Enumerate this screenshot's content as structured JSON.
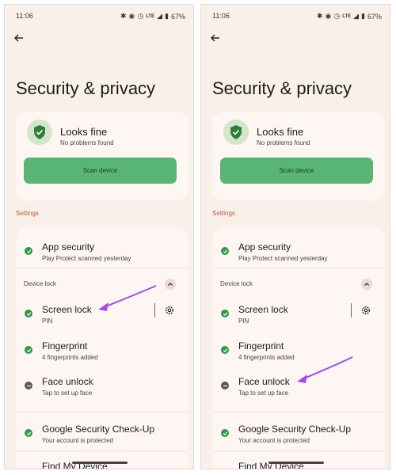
{
  "screens": [
    {
      "status": {
        "time": "11:06",
        "battery": "67%",
        "network": "LTE"
      },
      "page_title": "Security & privacy",
      "summary": {
        "title": "Looks fine",
        "subtitle": "No problems found",
        "scan_label": "Scan device"
      },
      "settings_label": "Settings",
      "items": {
        "app_security": {
          "title": "App security",
          "subtitle": "Play Protect scanned yesterday",
          "status": "ok"
        },
        "device_lock_label": "Device lock",
        "screen_lock": {
          "title": "Screen lock",
          "subtitle": "PIN",
          "status": "ok"
        },
        "fingerprint": {
          "title": "Fingerprint",
          "subtitle": "4 fingerprints added",
          "status": "ok"
        },
        "face_unlock": {
          "title": "Face unlock",
          "subtitle": "Tap to set up face",
          "status": "off"
        },
        "google_checkup": {
          "title": "Google Security Check-Up",
          "subtitle": "Your account is protected",
          "status": "ok"
        },
        "find_device": {
          "title": "Find My Device"
        }
      },
      "highlight": "screen_lock"
    },
    {
      "status": {
        "time": "11:06",
        "battery": "67%",
        "network": "LTE"
      },
      "page_title": "Security & privacy",
      "summary": {
        "title": "Looks fine",
        "subtitle": "No problems found",
        "scan_label": "Scan device"
      },
      "settings_label": "Settings",
      "items": {
        "app_security": {
          "title": "App security",
          "subtitle": "Play Protect scanned yesterday",
          "status": "ok"
        },
        "device_lock_label": "Device lock",
        "screen_lock": {
          "title": "Screen lock",
          "subtitle": "PIN",
          "status": "ok"
        },
        "fingerprint": {
          "title": "Fingerprint",
          "subtitle": "4 fingerprints added",
          "status": "ok"
        },
        "face_unlock": {
          "title": "Face unlock",
          "subtitle": "Tap to set up face",
          "status": "off"
        },
        "google_checkup": {
          "title": "Google Security Check-Up",
          "subtitle": "Your account is protected",
          "status": "ok"
        },
        "find_device": {
          "title": "Find My Device"
        }
      },
      "highlight": "face_unlock"
    }
  ],
  "colors": {
    "accent_green": "#58b574",
    "ok_green": "#2f9a48",
    "arrow_purple": "#a24bf0",
    "background": "#faf0ea"
  }
}
